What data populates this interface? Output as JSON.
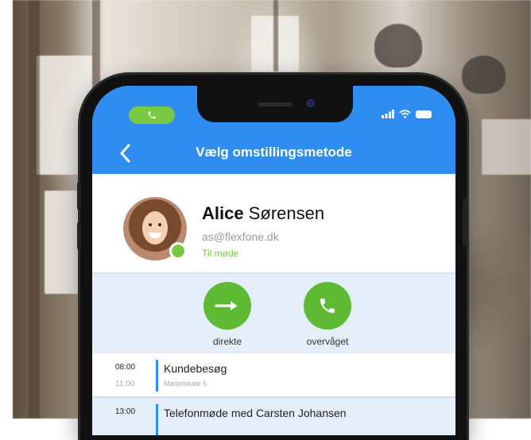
{
  "header": {
    "title": "Vælg omstillingsmetode",
    "back_icon": "chevron-left-icon",
    "call_icon": "phone-icon",
    "status_icons": [
      "signal-icon",
      "wifi-icon",
      "battery-icon"
    ]
  },
  "contact": {
    "first_name": "Alice",
    "last_name": "Sørensen",
    "email": "as@flexfone.dk",
    "status": "Til møde",
    "status_color": "#7ac943"
  },
  "methods": [
    {
      "label": "direkte",
      "icon": "arrow-right-icon"
    },
    {
      "label": "overvåget",
      "icon": "phone-icon"
    }
  ],
  "calendar": [
    {
      "start": "08:00",
      "end": "11:00",
      "title": "Kundebesøg",
      "location": "Mødelokale 5"
    },
    {
      "start": "13:00",
      "end": "",
      "title": "Telefonmøde med Carsten Johansen",
      "location": ""
    }
  ],
  "colors": {
    "accent": "#2f8df2",
    "green": "#5fba33",
    "methods_bg": "#e4eef9"
  }
}
